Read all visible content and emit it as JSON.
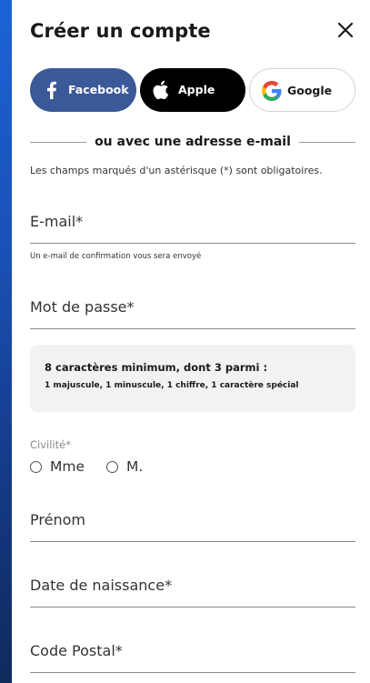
{
  "header": {
    "title": "Créer un compte",
    "close_icon": "close-icon"
  },
  "social": {
    "facebook": {
      "label": "Facebook",
      "icon": "facebook-icon",
      "color": "#3b5998"
    },
    "apple": {
      "label": "Apple",
      "icon": "apple-icon",
      "color": "#000000"
    },
    "google": {
      "label": "Google",
      "icon": "google-icon",
      "color": "#ffffff"
    }
  },
  "divider_text": "ou avec une adresse e-mail",
  "required_note": "Les champs marqués d'un astérisque (*) sont obligatoires.",
  "fields": {
    "email": {
      "label": "E-mail*",
      "helper": "Un e-mail de confirmation vous sera envoyé"
    },
    "password": {
      "label": "Mot de passe*"
    },
    "prenom": {
      "label": "Prénom"
    },
    "dob": {
      "label": "Date de naissance*"
    },
    "postal": {
      "label": "Code Postal*"
    }
  },
  "password_rules": {
    "title": "8 caractères minimum, dont 3 parmi :",
    "details": "1 majuscule, 1 minuscule, 1 chiffre, 1 caractère spécial"
  },
  "civility": {
    "label": "Civilité*",
    "options": [
      "Mme",
      "M."
    ]
  },
  "colors": {
    "side_strip": "#1a52b8",
    "facebook": "#3b5998",
    "apple": "#000000",
    "password_box": "#f2f2f2"
  }
}
